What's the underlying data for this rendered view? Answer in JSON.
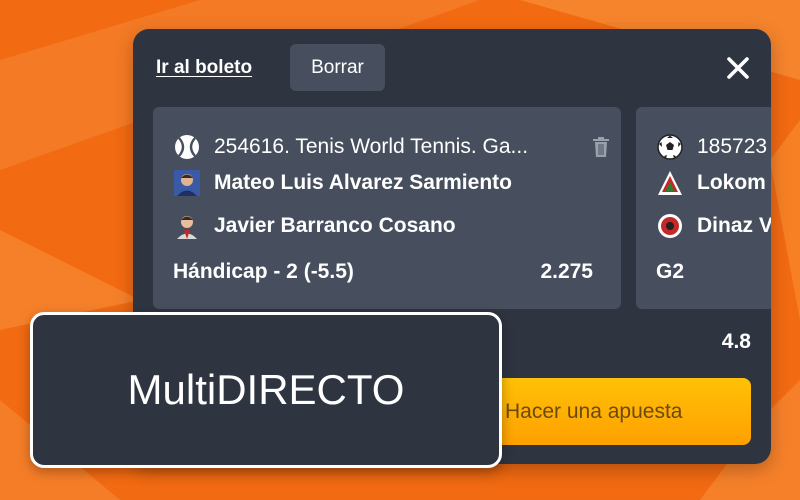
{
  "colors": {
    "background": "#f26a12",
    "panel": "#2e3440",
    "card": "#474f5e",
    "accent": "#ffb300",
    "text": "#ffffff"
  },
  "header": {
    "ticket_link": "Ir al boleto",
    "clear_button": "Borrar",
    "close_icon": "close-icon"
  },
  "bets": [
    {
      "sport_icon": "tennis-ball-icon",
      "event": "254616. Tenis World Tennis. Ga...",
      "team1": "Mateo Luis Alvarez Sarmiento",
      "team2": "Javier Barranco Cosano",
      "market": "Hándicap - 2 (-5.5)",
      "odds": "2.275"
    },
    {
      "sport_icon": "soccer-ball-icon",
      "event": "185723",
      "team1": "Lokom",
      "team2": "Dinaz V",
      "market": "G2",
      "odds": ""
    }
  ],
  "total_odds": "4.8",
  "place_bet_button": "Hacer una apuesta",
  "overlay_label": "MultiDIRECTO"
}
